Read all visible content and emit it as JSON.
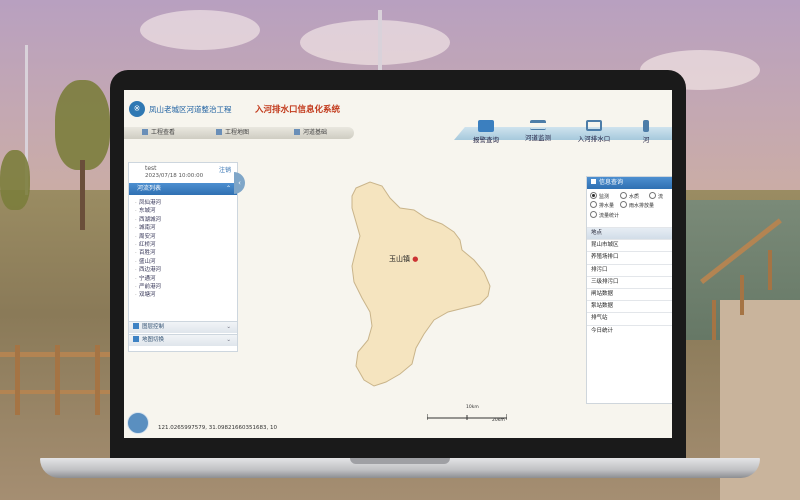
{
  "header": {
    "title_blue": "凤山老城区河道整治工程",
    "title_red": "入河排水口信息化系统",
    "logo_glyph": "※"
  },
  "nav": {
    "items": [
      {
        "label": "报警查询",
        "icon": "monitor-icon"
      },
      {
        "label": "河道监测",
        "icon": "bridge-icon"
      },
      {
        "label": "入河排水口",
        "icon": "outlet-icon"
      },
      {
        "label": "河",
        "icon": "river-icon"
      }
    ]
  },
  "toolbar": {
    "btn1": "工程查看",
    "btn2": "工程地图",
    "btn3": "河道基础"
  },
  "left_panel": {
    "user": "test",
    "logout": "注销",
    "time": "2023/07/18 10:00:00",
    "section_title": "河流列表",
    "rivers": [
      "凤仙港河",
      "东城河",
      "西湖城河",
      "城南河",
      "周安河",
      "红桥河",
      "百胜河",
      "盛山河",
      "西边港河",
      "宁通河",
      "严前港河",
      "双塘河"
    ],
    "section2": "图层控制",
    "section3": "地图切换",
    "chev": "⌄",
    "chev_up": "⌃",
    "collapse_glyph": "‹"
  },
  "map": {
    "town_label": "玉山镇",
    "town_dot": "●",
    "coords": "121.0265997579, 31.09821660351683, 10",
    "scale1": "10km",
    "scale2": "20km",
    "region_color": "#f5e4bf",
    "region_border": "#c9b48a"
  },
  "right_panel": {
    "title": "信息查询",
    "radios": [
      {
        "label": "监测",
        "checked": true
      },
      {
        "label": "水质",
        "checked": false
      },
      {
        "label": "流",
        "checked": false
      },
      {
        "label": "排水量",
        "checked": false
      },
      {
        "label": "雨水排放量",
        "checked": false
      },
      {
        "label": "流量统计",
        "checked": false
      }
    ],
    "rows": [
      "地点",
      "昆山市城区",
      "养殖场排口",
      "排污口",
      "三级排污口",
      "闸站数据",
      "泵站数据",
      "排气站",
      "今日统计"
    ]
  }
}
